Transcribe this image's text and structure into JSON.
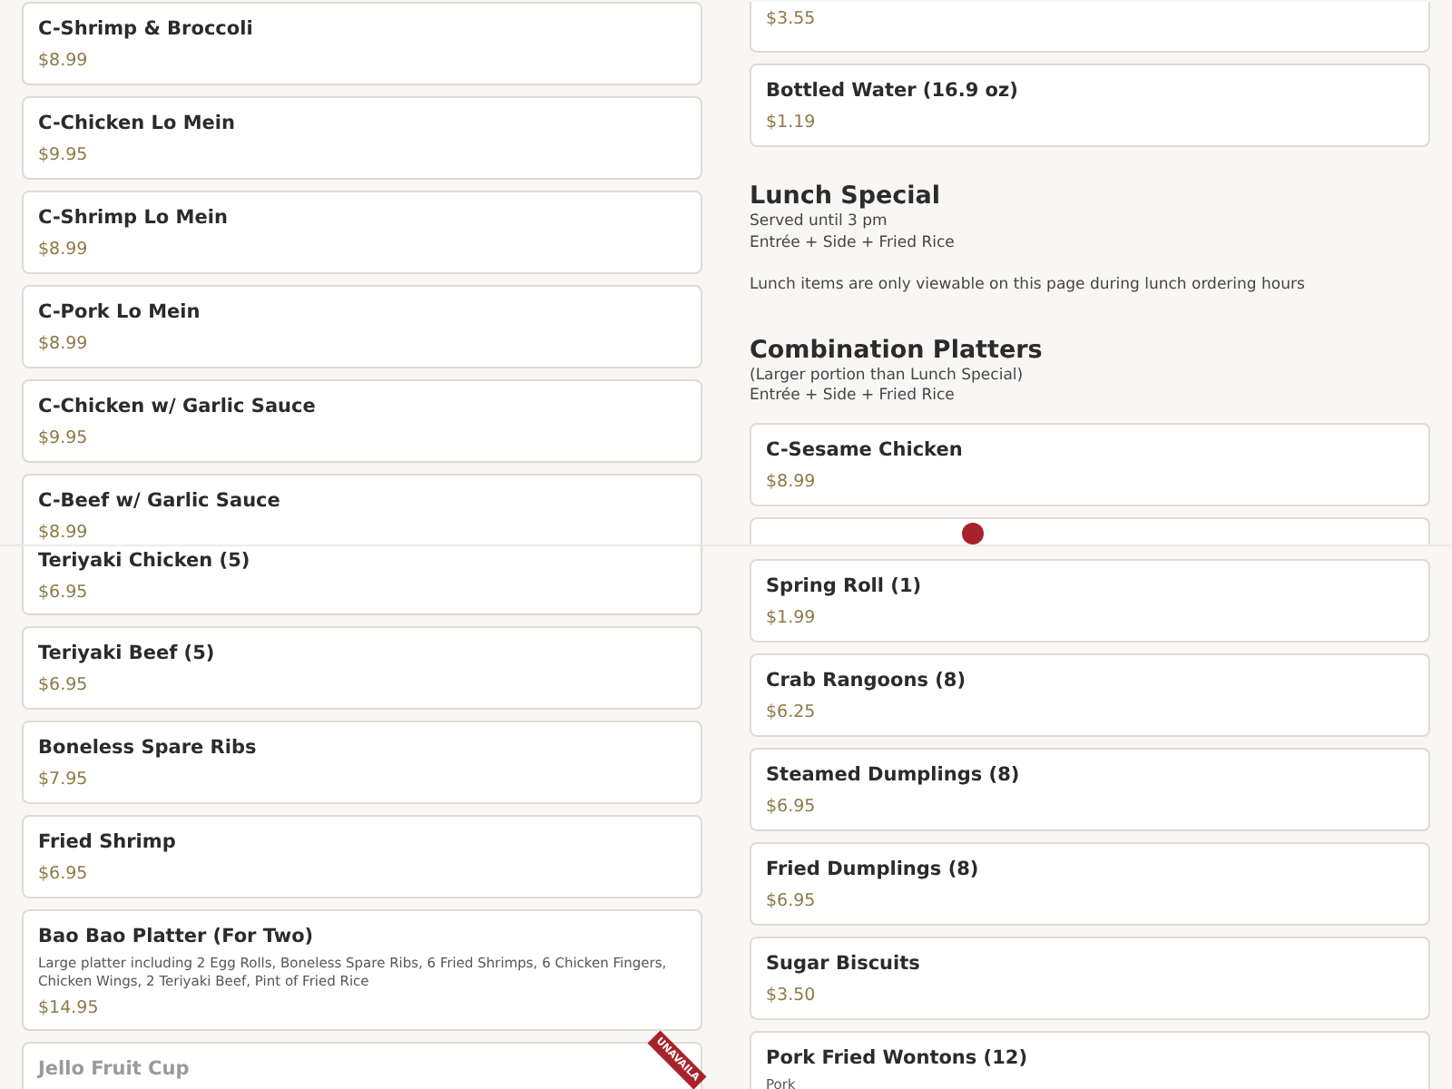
{
  "panels": [
    {
      "columns": [
        [
          {
            "kind": "item",
            "name": "C-Shrimp & Broccoli",
            "price": "$8.99"
          },
          {
            "kind": "item",
            "name": "C-Chicken Lo Mein",
            "price": "$9.95"
          },
          {
            "kind": "item",
            "name": "C-Shrimp Lo Mein",
            "price": "$8.99"
          },
          {
            "kind": "item",
            "name": "C-Pork Lo Mein",
            "price": "$8.99"
          },
          {
            "kind": "item",
            "name": "C-Chicken w/ Garlic Sauce",
            "price": "$9.95"
          },
          {
            "kind": "item",
            "name": "C-Beef w/ Garlic Sauce",
            "price": "$8.99"
          }
        ],
        [
          {
            "kind": "item",
            "cut_top": true,
            "price": "$3.55"
          },
          {
            "kind": "item",
            "name": "Bottled Water (16.9 oz)",
            "price": "$1.19"
          },
          {
            "kind": "section",
            "title": "Lunch Special",
            "lines": [
              "Served until 3 pm",
              "Entrée + Side + Fried Rice"
            ],
            "note": "Lunch items are only viewable on this page during lunch ordering hours"
          },
          {
            "kind": "section",
            "title": "Combination Platters",
            "lines": [
              "(Larger portion than Lunch Special)",
              "Entrée + Side + Fried Rice"
            ]
          },
          {
            "kind": "item",
            "name": "C-Sesame Chicken",
            "price": "$8.99"
          },
          {
            "kind": "dot_card"
          }
        ]
      ]
    },
    {
      "columns": [
        [
          {
            "kind": "item",
            "cut_top": true,
            "name": "Teriyaki Chicken (5)",
            "price": "$6.95"
          },
          {
            "kind": "item",
            "name": "Teriyaki Beef (5)",
            "price": "$6.95"
          },
          {
            "kind": "item",
            "name": "Boneless Spare Ribs",
            "price": "$7.95"
          },
          {
            "kind": "item",
            "name": "Fried Shrimp",
            "price": "$6.95"
          },
          {
            "kind": "item",
            "name": "Bao Bao Platter (For Two)",
            "description": "Large platter including 2 Egg Rolls, Boneless Spare Ribs, 6 Fried Shrimps, 6 Chicken Fingers, Chicken Wings, 2 Teriyaki Beef, Pint of Fried Rice",
            "price": "$14.95"
          },
          {
            "kind": "item",
            "name": "Jello Fruit Cup",
            "available": false,
            "ribbon": "UNAVAILA"
          }
        ],
        [
          {
            "kind": "item",
            "name": "Spring Roll (1)",
            "price": "$1.99"
          },
          {
            "kind": "item",
            "name": "Crab Rangoons (8)",
            "price": "$6.25"
          },
          {
            "kind": "item",
            "name": "Steamed Dumplings (8)",
            "price": "$6.95"
          },
          {
            "kind": "item",
            "name": "Fried Dumplings (8)",
            "price": "$6.95"
          },
          {
            "kind": "item",
            "name": "Sugar Biscuits",
            "price": "$3.50"
          },
          {
            "kind": "item",
            "name": "Pork Fried Wontons (12)",
            "description": "Pork"
          }
        ]
      ]
    }
  ]
}
